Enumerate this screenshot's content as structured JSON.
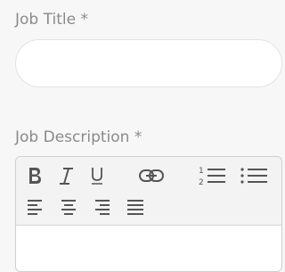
{
  "form": {
    "job_title": {
      "label": "Job Title *",
      "value": ""
    },
    "job_description": {
      "label": "Job Description *",
      "value": "",
      "toolbar": [
        "bold-icon",
        "italic-icon",
        "underline-icon",
        "link-icon",
        "ordered-list-icon",
        "unordered-list-icon",
        "align-left-icon",
        "align-center-icon",
        "align-right-icon",
        "align-justify-icon"
      ]
    }
  },
  "colors": {
    "background": "#f7f7f7",
    "label": "#8a8a8a",
    "icon": "#555555",
    "input_border": "#e3e3e3",
    "editor_border": "#cfcfcf",
    "toolbar_bg": "#f3f3f3"
  }
}
